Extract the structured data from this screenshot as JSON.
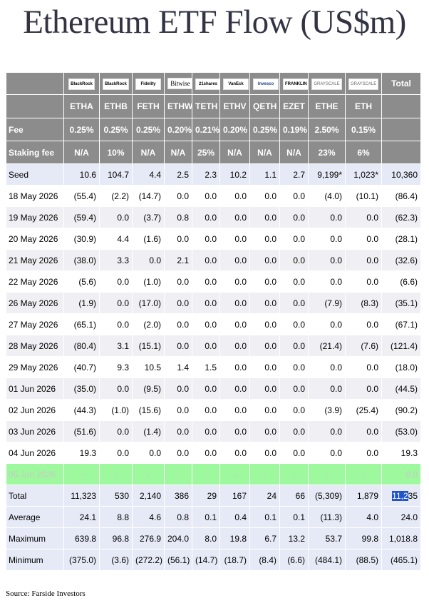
{
  "title": "Ethereum ETF Flow (US$m)",
  "source": "Source: Farside Investors",
  "logos": [
    "BlackRock",
    "BlackRock",
    "Fidelity",
    "Bitwise",
    "21shares",
    "VanEck",
    "Invesco",
    "FRANKLIN TEMPLETON",
    "GRAYSCALE",
    "GRAYSCALE"
  ],
  "total_label": "Total",
  "tickers": [
    "ETHA",
    "ETHB",
    "FETH",
    "ETHW",
    "TETH",
    "ETHV",
    "QETH",
    "EZET",
    "ETHE",
    "ETH"
  ],
  "fee": {
    "label": "Fee",
    "values": [
      "0.25%",
      "0.25%",
      "0.25%",
      "0.20%",
      "0.21%",
      "0.20%",
      "0.25%",
      "0.19%",
      "2.50%",
      "0.15%"
    ]
  },
  "staking": {
    "label": "Staking fee",
    "values": [
      "N/A",
      "10%",
      "N/A",
      "N/A",
      "25%",
      "N/A",
      "N/A",
      "N/A",
      "23%",
      "6%"
    ]
  },
  "rows": [
    {
      "label": "Seed",
      "values": [
        "10.6",
        "104.7",
        "4.4",
        "2.5",
        "2.3",
        "10.2",
        "1.1",
        "2.7",
        "9,199*",
        "1,023*",
        "10,360"
      ],
      "kind": "seed"
    },
    {
      "label": "18 May 2026",
      "values": [
        "(55.4)",
        "(2.2)",
        "(14.7)",
        "0.0",
        "0.0",
        "0.0",
        "0.0",
        "0.0",
        "(4.0)",
        "(10.1)",
        "(86.4)"
      ]
    },
    {
      "label": "19 May 2026",
      "values": [
        "(59.4)",
        "0.0",
        "(3.7)",
        "0.8",
        "0.0",
        "0.0",
        "0.0",
        "0.0",
        "0.0",
        "0.0",
        "(62.3)"
      ]
    },
    {
      "label": "20 May 2026",
      "values": [
        "(30.9)",
        "4.4",
        "(1.6)",
        "0.0",
        "0.0",
        "0.0",
        "0.0",
        "0.0",
        "0.0",
        "0.0",
        "(28.1)"
      ]
    },
    {
      "label": "21 May 2026",
      "values": [
        "(38.0)",
        "3.3",
        "0.0",
        "2.1",
        "0.0",
        "0.0",
        "0.0",
        "0.0",
        "0.0",
        "0.0",
        "(32.6)"
      ]
    },
    {
      "label": "22 May 2026",
      "values": [
        "(5.6)",
        "0.0",
        "(1.0)",
        "0.0",
        "0.0",
        "0.0",
        "0.0",
        "0.0",
        "0.0",
        "0.0",
        "(6.6)"
      ]
    },
    {
      "label": "26 May 2026",
      "values": [
        "(1.9)",
        "0.0",
        "(17.0)",
        "0.0",
        "0.0",
        "0.0",
        "0.0",
        "0.0",
        "(7.9)",
        "(8.3)",
        "(35.1)"
      ]
    },
    {
      "label": "27 May 2026",
      "values": [
        "(65.1)",
        "0.0",
        "(2.0)",
        "0.0",
        "0.0",
        "0.0",
        "0.0",
        "0.0",
        "0.0",
        "0.0",
        "(67.1)"
      ]
    },
    {
      "label": "28 May 2026",
      "values": [
        "(80.4)",
        "3.1",
        "(15.1)",
        "0.0",
        "0.0",
        "0.0",
        "0.0",
        "0.0",
        "(21.4)",
        "(7.6)",
        "(121.4)"
      ]
    },
    {
      "label": "29 May 2026",
      "values": [
        "(40.7)",
        "9.3",
        "10.5",
        "1.4",
        "1.5",
        "0.0",
        "0.0",
        "0.0",
        "0.0",
        "0.0",
        "(18.0)"
      ]
    },
    {
      "label": "01 Jun 2026",
      "values": [
        "(35.0)",
        "0.0",
        "(9.5)",
        "0.0",
        "0.0",
        "0.0",
        "0.0",
        "0.0",
        "0.0",
        "0.0",
        "(44.5)"
      ]
    },
    {
      "label": "02 Jun 2026",
      "values": [
        "(44.3)",
        "(1.0)",
        "(15.6)",
        "0.0",
        "0.0",
        "0.0",
        "0.0",
        "0.0",
        "(3.9)",
        "(25.4)",
        "(90.2)"
      ]
    },
    {
      "label": "03 Jun 2026",
      "values": [
        "(51.6)",
        "0.0",
        "(1.4)",
        "0.0",
        "0.0",
        "0.0",
        "0.0",
        "0.0",
        "0.0",
        "0.0",
        "(53.0)"
      ]
    },
    {
      "label": "04 Jun 2026",
      "values": [
        "19.3",
        "0.0",
        "0.0",
        "0.0",
        "0.0",
        "0.0",
        "0.0",
        "0.0",
        "0.0",
        "0.0",
        "19.3"
      ]
    },
    {
      "label": "05 Jun 2026",
      "values": [
        "-",
        "-",
        "-",
        "-",
        "-",
        "-",
        "-",
        "-",
        "-",
        "-",
        "0.0"
      ],
      "kind": "today"
    },
    {
      "label": "Total",
      "values": [
        "11,323",
        "530",
        "2,140",
        "386",
        "29",
        "167",
        "24",
        "66",
        "(5,309)",
        "1,879",
        "11,235"
      ],
      "kind": "total",
      "highlight": {
        "col": 10,
        "selected": "11,2",
        "rest": "35"
      }
    },
    {
      "label": "Average",
      "values": [
        "24.1",
        "8.8",
        "4.6",
        "0.8",
        "0.1",
        "0.4",
        "0.1",
        "0.1",
        "(11.3)",
        "4.0",
        "24.0"
      ],
      "kind": "stats"
    },
    {
      "label": "Maximum",
      "values": [
        "639.8",
        "96.8",
        "276.9",
        "204.0",
        "8.0",
        "19.8",
        "6.7",
        "13.2",
        "53.7",
        "99.8",
        "1,018.8"
      ],
      "kind": "stats"
    },
    {
      "label": "Minimum",
      "values": [
        "(375.0)",
        "(3.6)",
        "(272.2)",
        "(56.1)",
        "(14.7)",
        "(18.7)",
        "(8.4)",
        "(6.6)",
        "(484.1)",
        "(88.5)",
        "(465.1)"
      ],
      "kind": "stats"
    }
  ]
}
